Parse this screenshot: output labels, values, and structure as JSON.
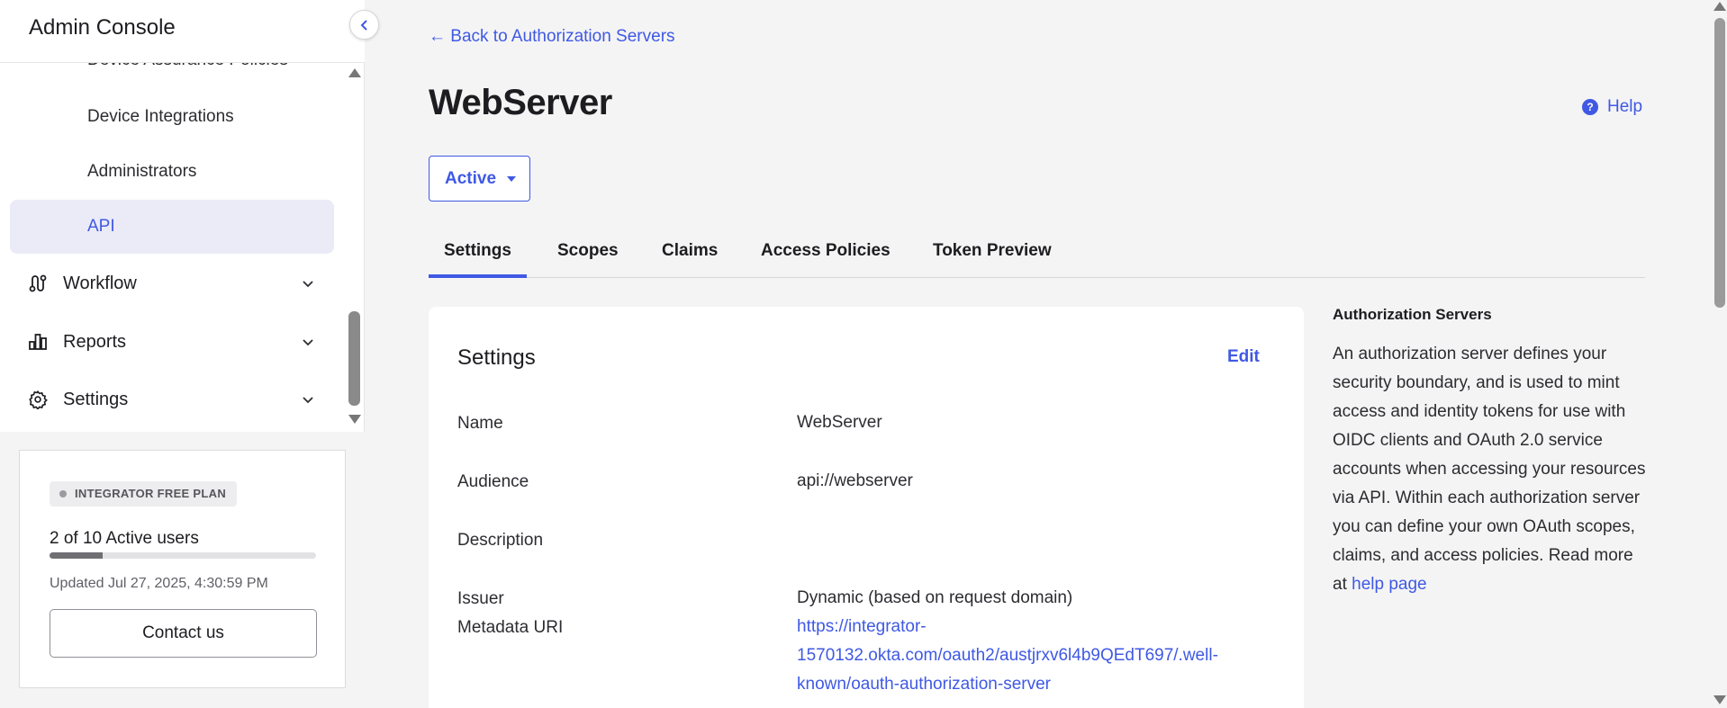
{
  "sidebar": {
    "title": "Admin Console",
    "sub_items": [
      {
        "label": "Device Assurance Policies"
      },
      {
        "label": "Device Integrations"
      },
      {
        "label": "Administrators"
      },
      {
        "label": "API",
        "active": true
      }
    ],
    "groups": [
      {
        "label": "Workflow",
        "icon": "workflow-icon"
      },
      {
        "label": "Reports",
        "icon": "reports-icon"
      },
      {
        "label": "Settings",
        "icon": "gear-icon"
      }
    ]
  },
  "plan": {
    "badge": "INTEGRATOR FREE PLAN",
    "users": "2 of 10 Active users",
    "users_fraction": 0.2,
    "updated": "Updated Jul 27, 2025, 4:30:59 PM",
    "contact": "Contact us"
  },
  "header": {
    "back_link": "← Back to Authorization Servers",
    "title": "WebServer",
    "help": "Help",
    "status": "Active"
  },
  "tabs": [
    {
      "label": "Settings",
      "active": true
    },
    {
      "label": "Scopes"
    },
    {
      "label": "Claims"
    },
    {
      "label": "Access Policies"
    },
    {
      "label": "Token Preview"
    }
  ],
  "settings_card": {
    "title": "Settings",
    "edit": "Edit",
    "rows": {
      "name": {
        "label": "Name",
        "value": "WebServer"
      },
      "audience": {
        "label": "Audience",
        "value": "api://webserver"
      },
      "description": {
        "label": "Description",
        "value": ""
      },
      "issuer": {
        "label": "Issuer",
        "value": "Dynamic (based on request domain)"
      },
      "metadata": {
        "label": "Metadata URI",
        "value": "https://integrator-1570132.okta.com/oauth2/austjrxv6l4b9QEdT697/.well-known/oauth-authorization-server"
      }
    }
  },
  "aside": {
    "title": "Authorization Servers",
    "text": "An authorization server defines your security boundary, and is used to mint access and identity tokens for use with OIDC clients and OAuth 2.0 service accounts when accessing your resources via API. Within each authorization server you can define your own OAuth scopes, claims, and access policies. Read more at ",
    "link": "help page"
  },
  "colors": {
    "accent": "#3f59e4",
    "active_nav_bg": "#ebebf7",
    "page_bg": "#f4f4f4"
  }
}
